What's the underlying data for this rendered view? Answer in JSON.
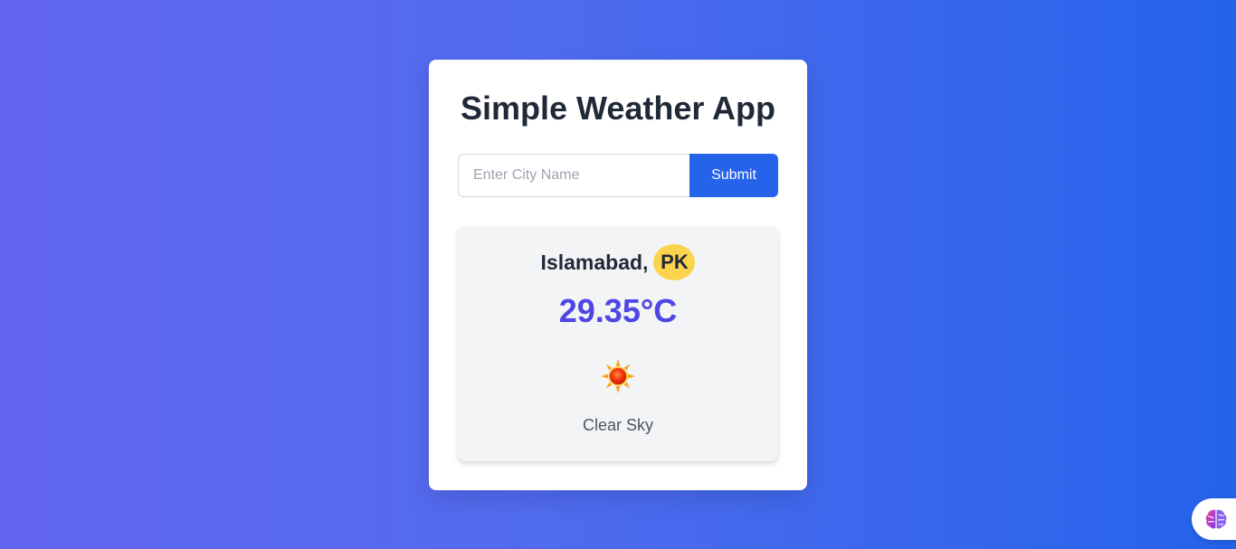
{
  "app": {
    "title": "Simple Weather App"
  },
  "search": {
    "placeholder": "Enter City Name",
    "value": "",
    "submit_label": "Submit"
  },
  "weather": {
    "city": "Islamabad,",
    "country": "PK",
    "temperature": "29.35°C",
    "description": "Clear Sky",
    "icon": "sun-icon"
  },
  "colors": {
    "background_start": "#6366f1",
    "background_end": "#2563eb",
    "accent": "#2563eb",
    "temperature": "#4f46e5",
    "badge": "#fcd34d"
  },
  "floating_button": {
    "icon": "brain-icon"
  }
}
